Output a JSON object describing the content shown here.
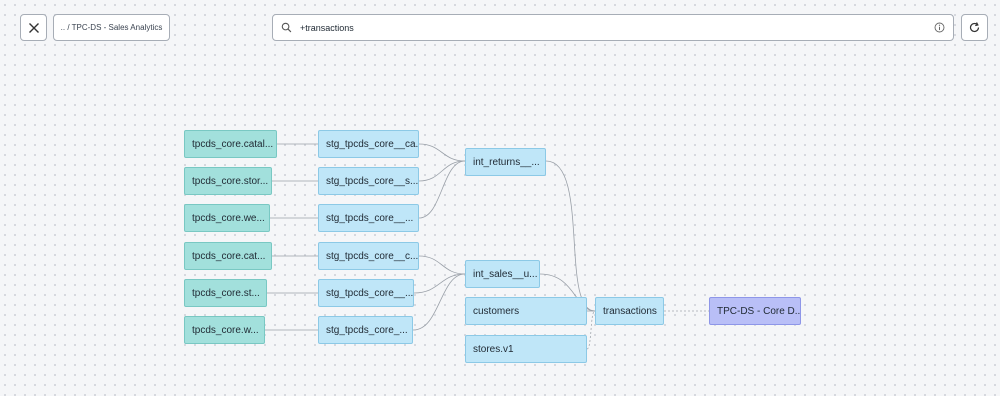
{
  "header": {
    "breadcrumb": ".. / TPC-DS - Sales Analytics",
    "search_value": "+transactions",
    "icons": {
      "close": "close-icon",
      "search": "search-icon",
      "info": "info-icon",
      "refresh": "refresh-icon"
    }
  },
  "lineage": {
    "sources": [
      "tpcds_core.catal...",
      "tpcds_core.stor...",
      "tpcds_core.we...",
      "tpcds_core.cat...",
      "tpcds_core.st...",
      "tpcds_core.w..."
    ],
    "staging": [
      "stg_tpcds_core__ca...",
      "stg_tpcds_core__s...",
      "stg_tpcds_core__...",
      "stg_tpcds_core__c...",
      "stg_tpcds_core__...",
      "stg_tpcds_core_..."
    ],
    "intermediate": [
      "int_returns__...",
      "int_sales__u..."
    ],
    "models": [
      "customers",
      "stores.v1",
      "transactions"
    ],
    "exposure": "TPC-DS - Core D...",
    "colors": {
      "source": "#a2e0dc",
      "model": "#bfe6f8",
      "exposure": "#b9bff7",
      "edge": "#9aa0a8"
    }
  }
}
